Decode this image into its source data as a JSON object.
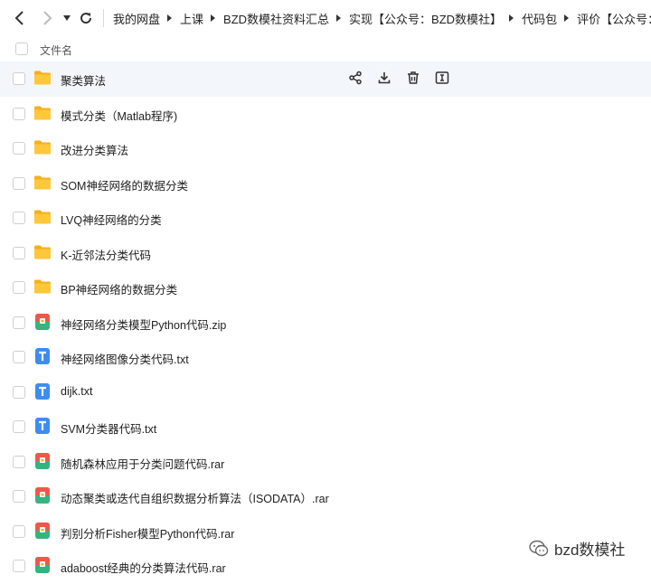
{
  "nav": {
    "back_icon": "chevron-left-icon",
    "forward_icon": "chevron-right-icon",
    "dropdown_icon": "caret-down-icon",
    "refresh_icon": "refresh-icon"
  },
  "breadcrumb": [
    "我的网盘",
    "上课",
    "BZD数模社资料汇总",
    "实现【公众号：BZD数模社】",
    "代码包",
    "评价【公众号：BZD数模"
  ],
  "header": {
    "column_name": "文件名"
  },
  "files": [
    {
      "name": "聚类算法",
      "type": "folder"
    },
    {
      "name": "模式分类（Matlab程序)",
      "type": "folder"
    },
    {
      "name": "改进分类算法",
      "type": "folder"
    },
    {
      "name": "SOM神经网络的数据分类",
      "type": "folder"
    },
    {
      "name": "LVQ神经网络的分类",
      "type": "folder"
    },
    {
      "name": "K-近邻法分类代码",
      "type": "folder"
    },
    {
      "name": "BP神经网络的数据分类",
      "type": "folder"
    },
    {
      "name": "神经网络分类模型Python代码.zip",
      "type": "archive"
    },
    {
      "name": "神经网络图像分类代码.txt",
      "type": "text"
    },
    {
      "name": "dijk.txt",
      "type": "text"
    },
    {
      "name": "SVM分类器代码.txt",
      "type": "text"
    },
    {
      "name": "随机森林应用于分类问题代码.rar",
      "type": "archive"
    },
    {
      "name": "动态聚类或迭代自组织数据分析算法（ISODATA）.rar",
      "type": "archive"
    },
    {
      "name": "判别分析Fisher模型Python代码.rar",
      "type": "archive"
    },
    {
      "name": "adaboost经典的分类算法代码.rar",
      "type": "archive"
    }
  ],
  "row_actions": [
    "share-icon",
    "download-icon",
    "delete-icon",
    "rename-icon"
  ],
  "watermark": {
    "text": "bzd数模社"
  },
  "colors": {
    "folder": "#ffc73a",
    "folder_tab": "#f5b01e",
    "text_file": "#3d8cf0",
    "archive_a": "#f0574a",
    "archive_b": "#36b37e",
    "hover_bg": "#f3f6fb"
  }
}
